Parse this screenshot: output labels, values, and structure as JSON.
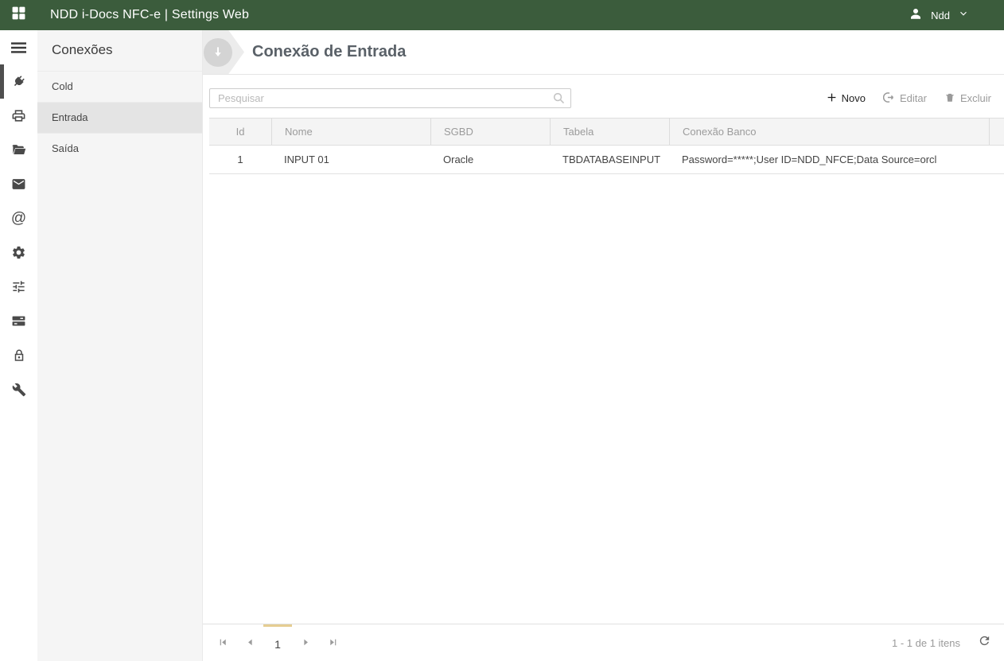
{
  "colors": {
    "topbar_green": "#3b5c3c",
    "sidebar_selected_bg": "#e4e4e4",
    "selected_page_indicator": "#e5cd92"
  },
  "topbar": {
    "title": "NDD i-Docs NFC-e | Settings Web",
    "user_name": "Ndd",
    "icons": [
      "grid-logo-icon",
      "user-icon",
      "chevron-down-icon"
    ]
  },
  "iconbar": {
    "menu_icon": "hamburger-menu-icon",
    "items": [
      {
        "icon": "plug-icon",
        "selected": true
      },
      {
        "icon": "printer-icon",
        "selected": false
      },
      {
        "icon": "folder-icon",
        "selected": false
      },
      {
        "icon": "mail-icon",
        "selected": false
      },
      {
        "icon": "at-sign-icon",
        "selected": false
      },
      {
        "icon": "gear-icon",
        "selected": false
      },
      {
        "icon": "sliders-icon",
        "selected": false
      },
      {
        "icon": "server-icon",
        "selected": false
      },
      {
        "icon": "lock-icon",
        "selected": false
      },
      {
        "icon": "wrench-icon",
        "selected": false
      }
    ]
  },
  "sidebar": {
    "title": "Conexões",
    "items": [
      {
        "label": "Cold",
        "selected": false
      },
      {
        "label": "Entrada",
        "selected": true
      },
      {
        "label": "Saída",
        "selected": false
      }
    ]
  },
  "main": {
    "page_title": "Conexão de Entrada",
    "header_icon": "circle-down-arrow-icon",
    "toolbar": {
      "search_placeholder": "Pesquisar",
      "search_value": "",
      "buttons": {
        "new": "Novo",
        "edit": "Editar",
        "delete": "Excluir"
      }
    },
    "table": {
      "columns": [
        "Id",
        "Nome",
        "SGBD",
        "Tabela",
        "Conexão Banco"
      ],
      "rows": [
        [
          "1",
          "INPUT 01",
          "Oracle",
          "TBDATABASEINPUT",
          "Password=*****;User ID=NDD_NFCE;Data Source=orcl"
        ]
      ]
    },
    "pager": {
      "current_page": "1",
      "info": "1 - 1 de 1 itens",
      "refresh_icon": "refresh-icon"
    }
  }
}
